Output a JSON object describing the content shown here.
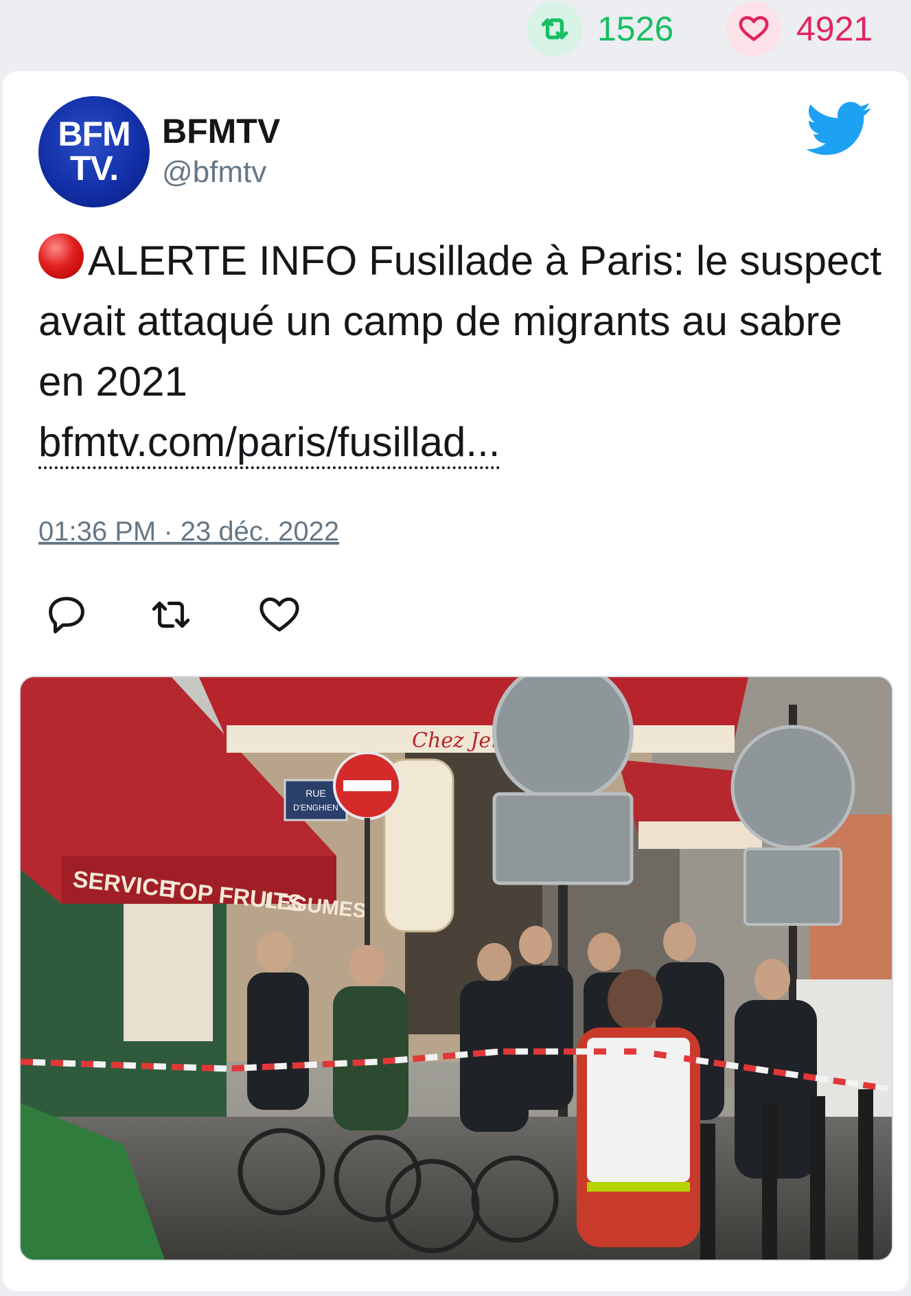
{
  "stats": {
    "retweets": "1526",
    "likes": "4921"
  },
  "author": {
    "avatar_line1": "BFM",
    "avatar_line2": "TV.",
    "name": "BFMTV",
    "handle": "@bfmtv"
  },
  "tweet": {
    "text": "ALERTE INFO Fusillade à Paris: le suspect avait attaqué un camp de migrants au sabre en 2021",
    "link": "bfmtv.com/paris/fusillad...",
    "timestamp": "01:36 PM · 23 déc. 2022"
  },
  "photo": {
    "shop_sign": "TOP FRUITS",
    "awning_word1": "SERVICE",
    "awning_word2": "LEGUMES",
    "street_sign_line1": "RUE",
    "street_sign_line2": "D'ENGHIEN",
    "cafe_sign": "Chez Jenny"
  },
  "colors": {
    "retweet_green": "#17bf63",
    "like_red": "#e0245e",
    "twitter_blue": "#1da1f2",
    "text": "#14171a",
    "muted": "#657786"
  },
  "icons": [
    "retweet-icon",
    "heart-icon",
    "twitter-bird-icon",
    "red-circle-icon",
    "reply-icon"
  ]
}
